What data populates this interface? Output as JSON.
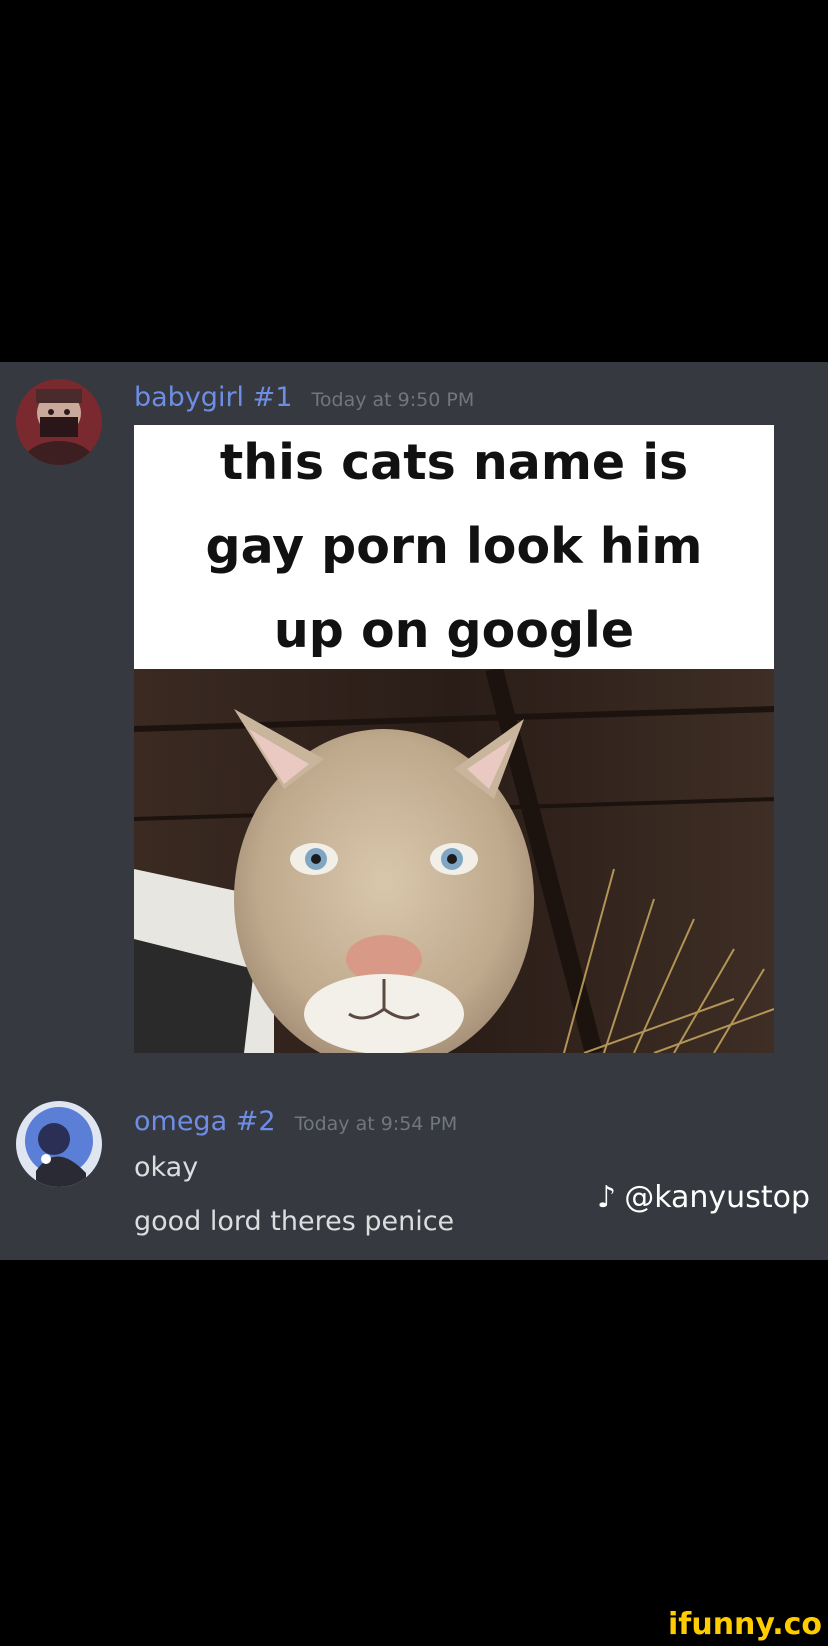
{
  "messages": [
    {
      "username": "babygirl #1",
      "username_color": "#6e8ee6",
      "timestamp": "Today at 9:50 PM",
      "attachment": {
        "caption": "this cats name is gay porn look him up on google"
      }
    },
    {
      "username": "omega #2",
      "username_color": "#6e8ee6",
      "timestamp": "Today at 9:54 PM",
      "lines": [
        "okay",
        "good lord theres penice"
      ]
    }
  ],
  "watermarks": {
    "tiktok_handle": "@kanyustop",
    "tiktok_icon": "tiktok-icon",
    "site": "ifunny.co"
  },
  "colors": {
    "background": "#000000",
    "chat_background": "#36393f",
    "message_text": "#dcddde",
    "timestamp": "#72767d",
    "ifunny": "#ffcc00"
  }
}
